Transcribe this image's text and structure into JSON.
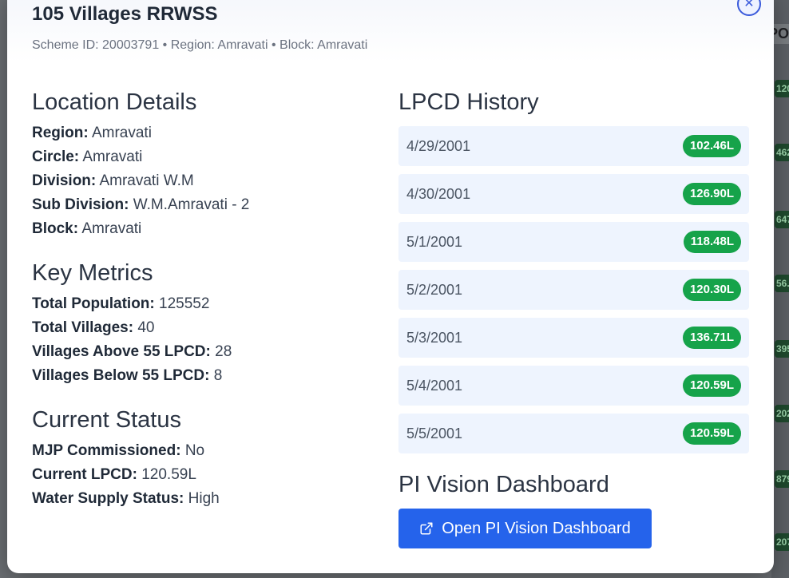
{
  "header": {
    "title": "105 Villages RRWSS",
    "subtitle": "Scheme ID: 20003791 • Region: Amravati • Block: Amravati"
  },
  "location": {
    "heading": "Location Details",
    "items": [
      {
        "key": "Region:",
        "value": "Amravati"
      },
      {
        "key": "Circle:",
        "value": "Amravati"
      },
      {
        "key": "Division:",
        "value": "Amravati W.M"
      },
      {
        "key": "Sub Division:",
        "value": "W.M.Amravati - 2"
      },
      {
        "key": "Block:",
        "value": "Amravati"
      }
    ]
  },
  "metrics": {
    "heading": "Key Metrics",
    "items": [
      {
        "key": "Total Population:",
        "value": "125552"
      },
      {
        "key": "Total Villages:",
        "value": "40"
      },
      {
        "key": "Villages Above 55 LPCD:",
        "value": "28"
      },
      {
        "key": "Villages Below 55 LPCD:",
        "value": "8"
      }
    ]
  },
  "status": {
    "heading": "Current Status",
    "items": [
      {
        "key": "MJP Commissioned:",
        "value": "No"
      },
      {
        "key": "Current LPCD:",
        "value": "120.59L"
      },
      {
        "key": "Water Supply Status:",
        "value": "High"
      }
    ]
  },
  "history": {
    "heading": "LPCD History",
    "rows": [
      {
        "date": "4/29/2001",
        "value": "102.46L"
      },
      {
        "date": "4/30/2001",
        "value": "126.90L"
      },
      {
        "date": "5/1/2001",
        "value": "118.48L"
      },
      {
        "date": "5/2/2001",
        "value": "120.30L"
      },
      {
        "date": "5/3/2001",
        "value": "136.71L"
      },
      {
        "date": "5/4/2001",
        "value": "120.59L"
      },
      {
        "date": "5/5/2001",
        "value": "120.59L"
      }
    ]
  },
  "pi": {
    "heading": "PI Vision Dashboard",
    "button_label": "Open PI Vision Dashboard",
    "button_icon": "external-link-icon"
  },
  "colors": {
    "accent": "#2563eb",
    "badge": "#16a34a",
    "row_bg": "#eef4fe"
  }
}
